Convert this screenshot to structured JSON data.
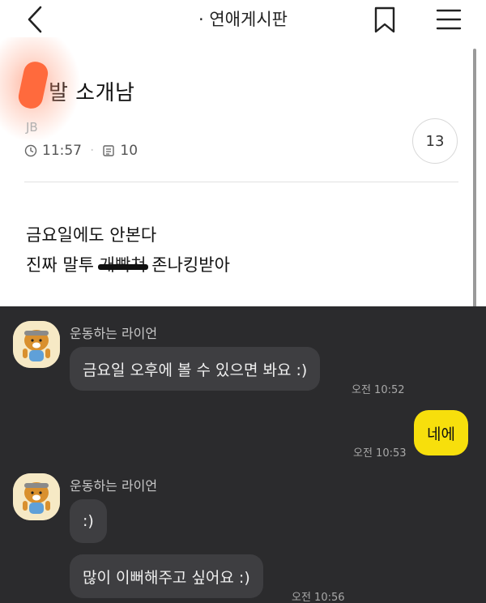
{
  "header": {
    "back_icon": "chevron-left-icon",
    "title": "· 연애게시판",
    "bookmark_icon": "bookmark-icon",
    "menu_icon": "hamburger-menu-icon"
  },
  "post": {
    "title": "발 소개남",
    "author": "JB",
    "time": "11:57",
    "views": "10",
    "comment_count": "13",
    "body_line1": "금요일에도 안본다",
    "body_line2_pre": "진짜 말투 ",
    "body_line2_struck": "개빡쳐",
    "body_line2_post": " 존나킹받아"
  },
  "chat": {
    "messages": [
      {
        "sender": "운동하는 라이언",
        "text": "금요일 오후에 볼 수 있으면 봐요 :)",
        "time": "오전 10:52"
      },
      {
        "sender": "me",
        "text": "네에",
        "time": "오전 10:53"
      },
      {
        "sender": "운동하는 라이언",
        "text": ":)",
        "time": ""
      },
      {
        "sender": "운동하는 라이언",
        "text": "많이 이뻐해주고 싶어요 :)",
        "time": "오전 10:56"
      }
    ],
    "colors": {
      "background": "#2b2b2d",
      "bubble_other": "#3e3e41",
      "bubble_mine": "#f7df0c"
    }
  }
}
